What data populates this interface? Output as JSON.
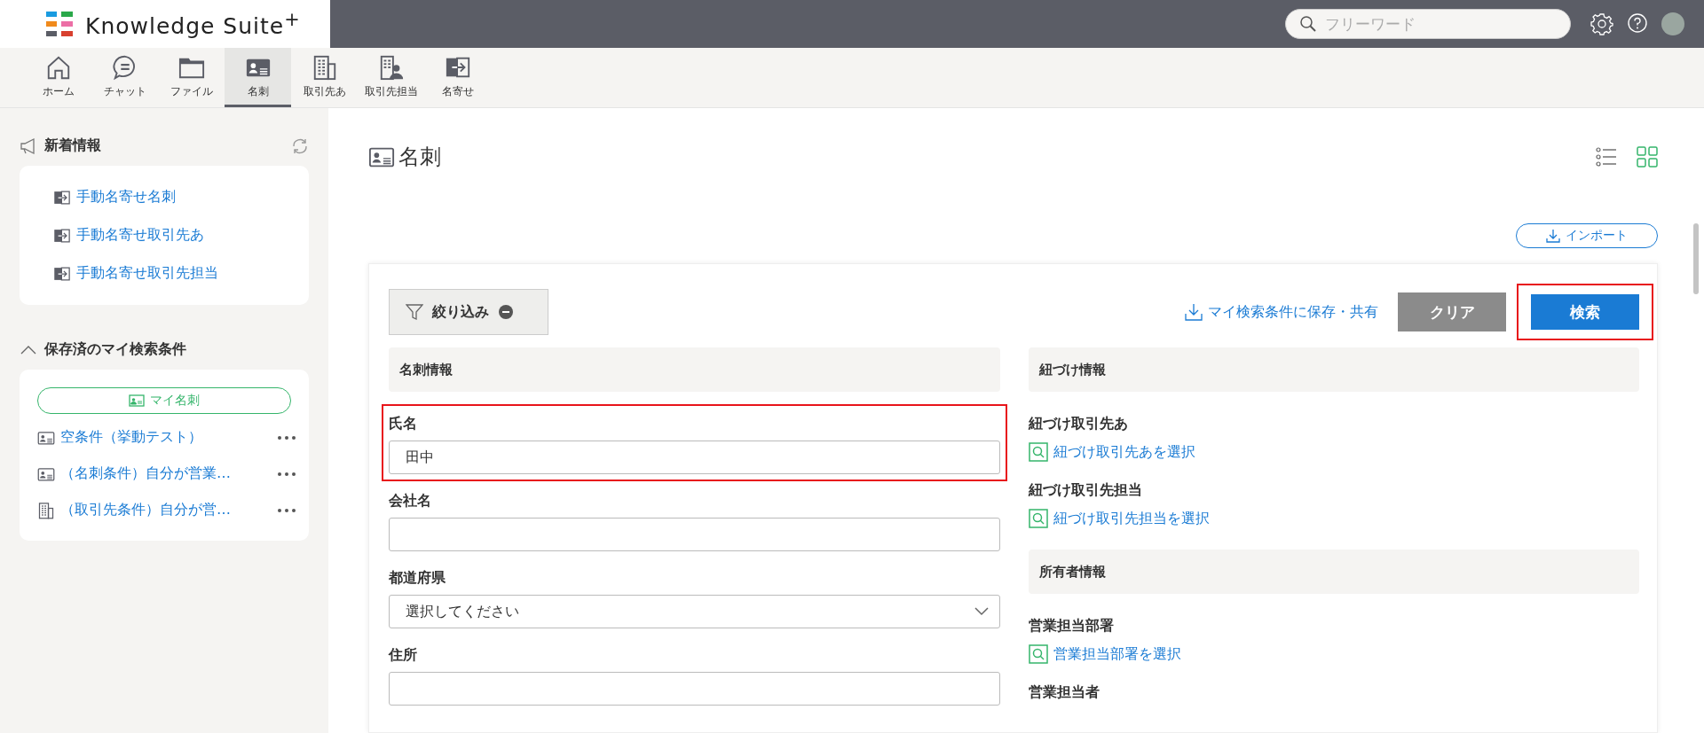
{
  "header": {
    "logo": "Knowledge Suite$^{+}$",
    "search": {
      "placeholder": "フリーワード"
    }
  },
  "nav_tabs": [
    {
      "label": "ホーム",
      "kind": "home",
      "selected": false
    },
    {
      "label": "チャット",
      "kind": "chat",
      "selected": false
    },
    {
      "label": "ファイル",
      "kind": "folder",
      "selected": false
    },
    {
      "label": "名刺",
      "kind": "card",
      "selected": true
    },
    {
      "label": "取引先あ",
      "kind": "building",
      "selected": false
    },
    {
      "label": "取引先担当",
      "kind": "contact",
      "selected": false
    },
    {
      "label": "名寄せ",
      "kind": "merge",
      "selected": false
    }
  ],
  "sidebar": {
    "news": {
      "title": "新着情報",
      "items": [
        "手動名寄せ名刺",
        "手動名寄せ取引先あ",
        "手動名寄せ取引先担当"
      ]
    },
    "saved": {
      "title": "保存済のマイ検索条件",
      "expanded": true,
      "my_card_button": "マイ名刺",
      "items": [
        {
          "label": "空条件（挙動テスト）",
          "kind": "card"
        },
        {
          "label": "（名刺条件）自分が営業…",
          "kind": "card"
        },
        {
          "label": "（取引先条件）自分が営…",
          "kind": "building"
        }
      ]
    }
  },
  "main": {
    "title": "名刺",
    "view_modes": [
      {
        "kind": "list",
        "selected": false
      },
      {
        "kind": "grid",
        "selected": true
      }
    ],
    "import_button": "インポート",
    "filter_button": "絞り込み",
    "save_link": "マイ検索条件に保存・共有",
    "clear_button": "クリア",
    "search_button": {
      "label": "検索",
      "highlighted": true
    },
    "left_sections": [
      {
        "title": "名刺情報",
        "fields": [
          {
            "label": "氏名",
            "kind": "text",
            "value": "田中",
            "highlighted": true
          },
          {
            "label": "会社名",
            "kind": "text",
            "highlighted": false
          },
          {
            "label": "都道府県",
            "kind": "select",
            "value": "選択してください",
            "highlighted": false
          },
          {
            "label": "住所",
            "kind": "text",
            "highlighted": false
          }
        ]
      }
    ],
    "right_sections": [
      {
        "title": "紐づけ情報",
        "fields": [
          {
            "label": "紐づけ取引先あ",
            "kind": "lookup",
            "link": "紐づけ取引先あを選択"
          },
          {
            "label": "紐づけ取引先担当",
            "kind": "lookup",
            "link": "紐づけ取引先担当を選択"
          }
        ]
      },
      {
        "title": "所有者情報",
        "fields": [
          {
            "label": "営業担当部署",
            "kind": "lookup",
            "link": "営業担当部署を選択"
          },
          {
            "label": "営業担当者",
            "kind": "lookup"
          }
        ]
      }
    ]
  }
}
